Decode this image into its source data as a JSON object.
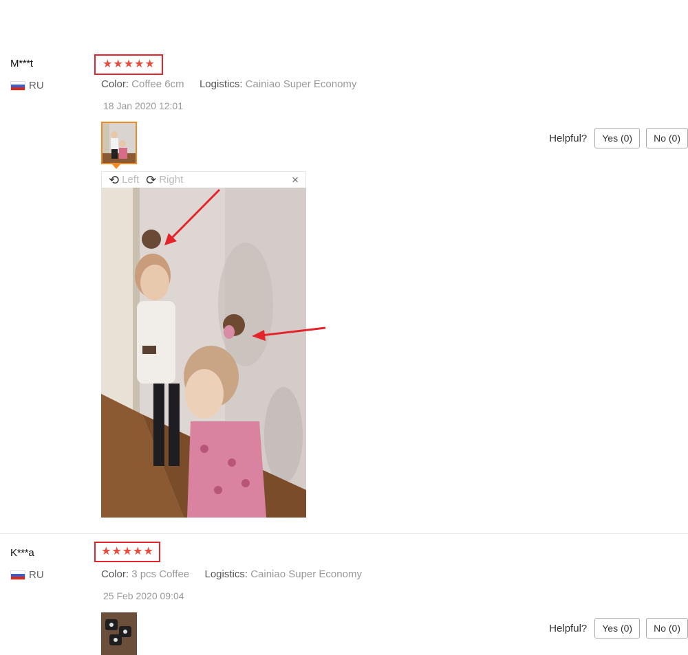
{
  "reviews": [
    {
      "user": "M***t",
      "country": "RU",
      "stars": 5,
      "color_key": "Color:",
      "color_val": "Coffee 6cm",
      "logistics_key": "Logistics:",
      "logistics_val": "Cainiao Super Economy",
      "date": "18 Jan 2020 12:01",
      "helpful_label": "Helpful?",
      "yes_label": "Yes (0)",
      "no_label": "No (0)"
    },
    {
      "user": "K***a",
      "country": "RU",
      "stars": 5,
      "color_key": "Color:",
      "color_val": "3 pcs Coffee",
      "logistics_key": "Logistics:",
      "logistics_val": "Cainiao Super Economy",
      "date": "25 Feb 2020 09:04",
      "helpful_label": "Helpful?",
      "yes_label": "Yes (0)",
      "no_label": "No (0)"
    }
  ],
  "viewer": {
    "rotate_left": "Left",
    "rotate_right": "Right",
    "close": "×"
  },
  "icons": {
    "star": "star-icon",
    "flag": "russia-flag-icon",
    "rotate_left": "rotate-left-icon",
    "rotate_right": "rotate-right-icon",
    "close": "close-icon"
  },
  "colors": {
    "star": "#e74c3c",
    "highlight_box": "#e3242b",
    "thumb_active": "#f08a24"
  }
}
